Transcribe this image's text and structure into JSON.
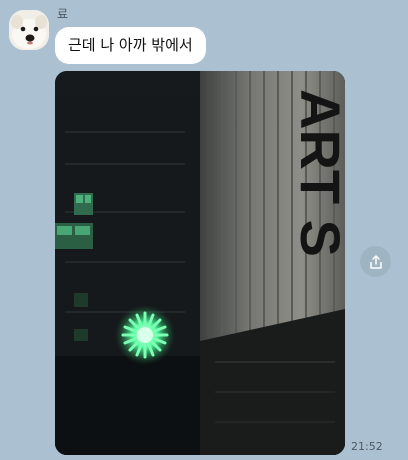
{
  "chat": {
    "sender_name": "료",
    "message_text": "근데 나 아까 밖에서",
    "timestamp": "21:52"
  },
  "photo": {
    "sign_text": "ART S"
  },
  "icons": {
    "avatar": "dog-face-avatar",
    "share": "share-icon"
  },
  "colors": {
    "chat_background": "#abc1d1",
    "bubble": "#ffffff",
    "green_light": "#4dff9a"
  }
}
